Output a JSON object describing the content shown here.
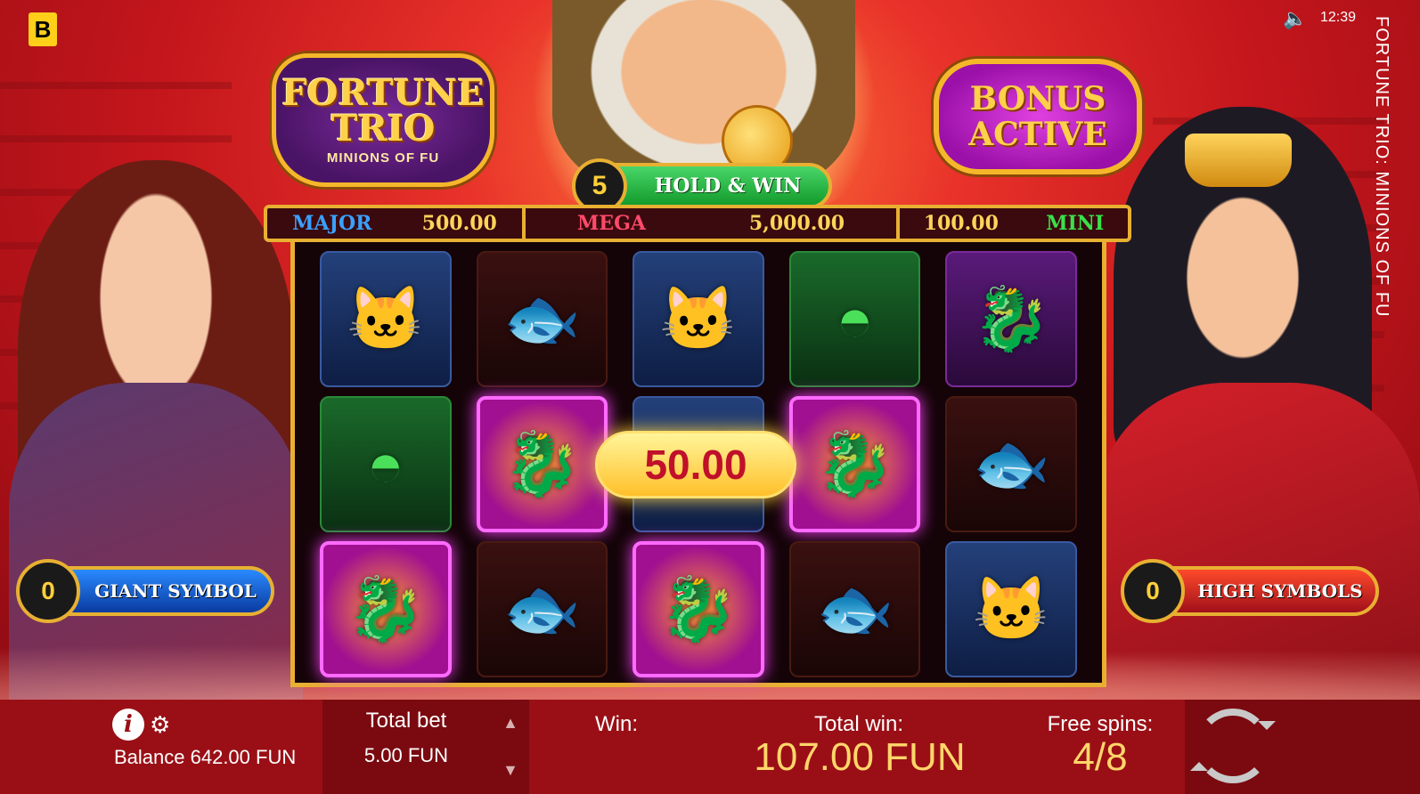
{
  "brand": "B",
  "status": {
    "time": "12:39",
    "sound_icon": "speaker-icon"
  },
  "game_title_vertical": "FORTUNE TRIO: MINIONS OF FU",
  "logo": {
    "line1": "FORTUNE",
    "line2": "TRIO",
    "line3": "MINIONS OF FU"
  },
  "bonus": {
    "line1": "BONUS",
    "line2": "ACTIVE"
  },
  "hold_win": {
    "count": "5",
    "label": "HOLD & WIN"
  },
  "jackpots": {
    "major_label": "MAJOR",
    "major_value": "500.00",
    "mega_label": "MEGA",
    "mega_value": "5,000.00",
    "mini_value": "100.00",
    "mini_label": "MINI"
  },
  "reels": {
    "symbols": [
      [
        "lucky-cat",
        "koi-fish",
        "lucky-cat",
        "green-fan",
        "dragon-ingot"
      ],
      [
        "green-fan",
        "dragon-ingot-hot",
        "lucky-cat",
        "dragon-ingot-hot",
        "koi-fish"
      ],
      [
        "dragon-ingot-hot",
        "koi-fish",
        "dragon-ingot-hot",
        "koi-fish",
        "lucky-cat"
      ]
    ],
    "win_value": "50.00"
  },
  "features": {
    "giant_count": "0",
    "giant_label": "GIANT SYMBOL",
    "high_count": "0",
    "high_label": "HIGH SYMBOLS"
  },
  "bottom": {
    "balance": "Balance 642.00 FUN",
    "total_bet_label": "Total bet",
    "total_bet_value": "5.00 FUN",
    "win_label": "Win:",
    "total_win_label": "Total win:",
    "total_win_value": "107.00 FUN",
    "free_spins_label": "Free spins:",
    "free_spins_value": "4/8",
    "info_icon": "i"
  },
  "colors": {
    "major": "#3aa0ff",
    "mega": "#ff4a6a",
    "mini": "#3ae04a",
    "gold": "#e8b032",
    "bar": "#9a0f16"
  }
}
